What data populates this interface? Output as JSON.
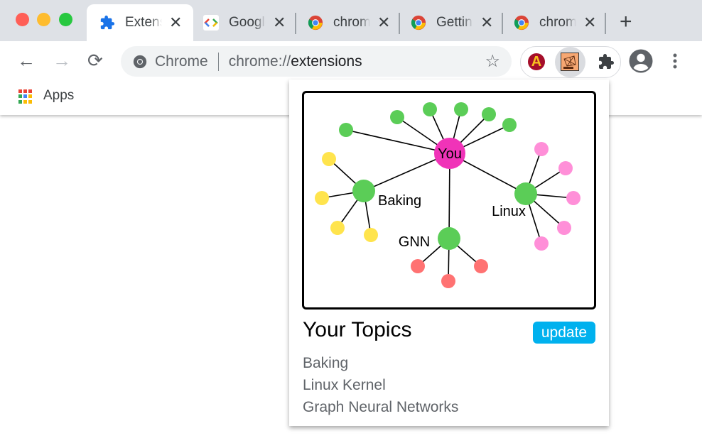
{
  "window": {
    "traffic_lights": [
      "#ff5f57",
      "#febc2e",
      "#28c840"
    ]
  },
  "tabs": [
    {
      "title": "Extensions",
      "icon": "extensions-puzzle-icon",
      "active": true
    },
    {
      "title": "Google Developers",
      "icon": "google-developers-icon",
      "active": false
    },
    {
      "title": "chrome",
      "icon": "chrome-icon",
      "active": false
    },
    {
      "title": "Getting Started",
      "icon": "chrome-icon",
      "active": false
    },
    {
      "title": "chrome",
      "icon": "chrome-icon",
      "active": false
    }
  ],
  "tab_close_glyph": "✕",
  "new_tab_glyph": "+",
  "toolbar": {
    "back_glyph": "←",
    "forward_glyph": "→",
    "reload_glyph": "⟳",
    "site_label": "Chrome",
    "url_prefix": "chrome://",
    "url_host": "extensions",
    "bookmark_star": "☆",
    "ext_a_letter": "A"
  },
  "bookmarks": {
    "apps_label": "Apps"
  },
  "popup": {
    "graph": {
      "center_label": "You",
      "topics": [
        {
          "label": "Baking",
          "leaf_color": "#ffe44d",
          "leaves": 4
        },
        {
          "label": "Linux",
          "leaf_color": "#ff8fd8",
          "leaves": 5
        },
        {
          "label": "GNN",
          "leaf_color": "#ff7272",
          "leaves": 3
        }
      ],
      "you_direct_leaves": 6,
      "colors": {
        "center": "#f033b8",
        "topic": "#5bcd57",
        "direct_leaf": "#5bcd57",
        "edge": "#000000"
      }
    },
    "title": "Your Topics",
    "update_label": "update",
    "update_color": "#00b1ee",
    "topics": [
      "Baking",
      "Linux Kernel",
      "Graph Neural Networks"
    ]
  }
}
